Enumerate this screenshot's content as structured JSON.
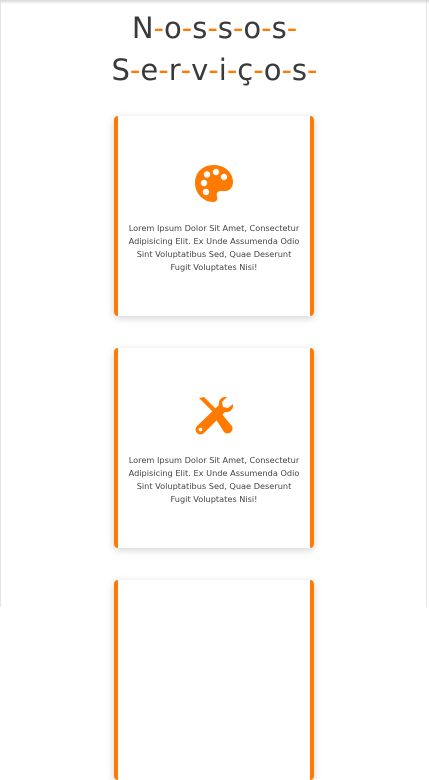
{
  "header": {
    "title_line1": [
      "N",
      "o",
      "s",
      "s",
      "o",
      "s"
    ],
    "title_line2": [
      "S",
      "e",
      "r",
      "v",
      "i",
      "ç",
      "o",
      "s"
    ],
    "separator": "-"
  },
  "colors": {
    "accent": "#ff7a00",
    "text": "#3a3a3a"
  },
  "cards": [
    {
      "icon": "palette-icon",
      "text": "Lorem Ipsum Dolor Sit Amet, Consectetur Adipisicing Elit. Ex Unde Assumenda Odio Sint Voluptatibus Sed, Quae Deserunt Fugit Voluptates Nisi!"
    },
    {
      "icon": "tools-icon",
      "text": "Lorem Ipsum Dolor Sit Amet, Consectetur Adipisicing Elit. Ex Unde Assumenda Odio Sint Voluptatibus Sed, Quae Deserunt Fugit Voluptates Nisi!"
    },
    {
      "icon": "",
      "text": ""
    }
  ]
}
